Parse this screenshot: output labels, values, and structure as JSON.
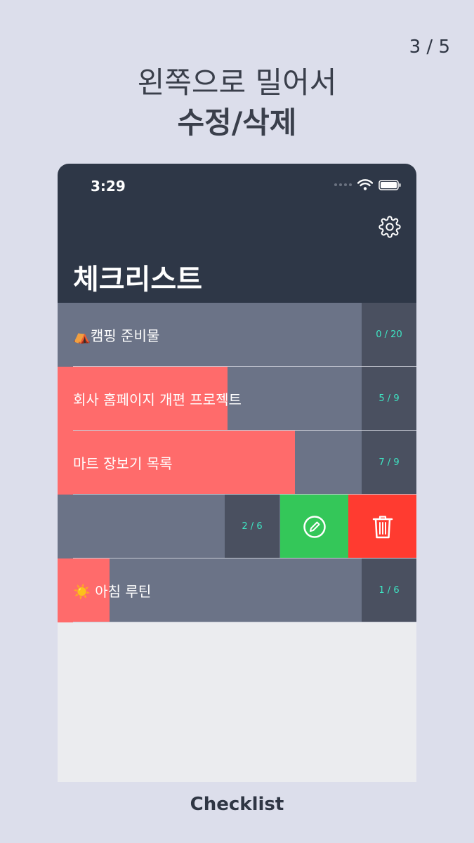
{
  "page_indicator": "3 / 5",
  "headline": {
    "line1": "왼쪽으로 밀어서",
    "line2": "수정/삭제"
  },
  "status_bar": {
    "time": "3:29"
  },
  "nav": {
    "title": "체크리스트"
  },
  "rows": [
    {
      "label": "⛺캠핑 준비물",
      "count": "0 / 20",
      "progress": 0.0
    },
    {
      "label": "회사 홈페이지 개편 프로젝트",
      "count": "5 / 9",
      "progress": 0.56
    },
    {
      "label": "마트 장보기 목록",
      "count": "7 / 9",
      "progress": 0.78
    },
    {
      "label": "",
      "count": "2 / 6",
      "progress": 0.33,
      "swiped": true
    },
    {
      "label": "☀️ 아침 루틴",
      "count": "1 / 6",
      "progress": 0.17
    }
  ],
  "actions": {
    "edit_color": "#34c759",
    "delete_color": "#ff3b30"
  },
  "colors": {
    "nav_bg": "#2e3747",
    "row_bg": "#6b7387",
    "progress_fill": "#ff6b6b",
    "count_text": "#3ee6c4"
  },
  "footer": {
    "app_name": "Checklist"
  }
}
